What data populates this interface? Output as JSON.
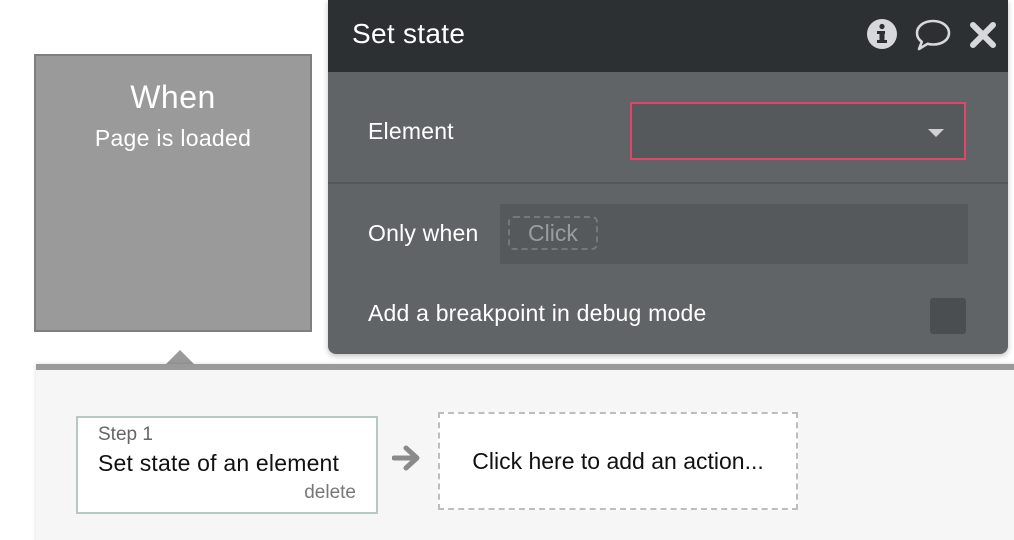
{
  "event": {
    "title": "When",
    "subtitle": "Page is loaded"
  },
  "workflow": {
    "step": {
      "label": "Step 1",
      "title": "Set state of an element",
      "delete_label": "delete"
    },
    "add_action_label": "Click here to add an action..."
  },
  "panel": {
    "title": "Set state",
    "icons": {
      "info": "info-icon",
      "comment": "comment-icon",
      "close": "close-icon"
    },
    "element": {
      "label": "Element",
      "value": ""
    },
    "only_when": {
      "label": "Only when",
      "chip_label": "Click"
    },
    "breakpoint": {
      "label": "Add a breakpoint in debug mode",
      "checked": false
    }
  },
  "colors": {
    "panel_header": "#2c3033",
    "panel_body": "#616466",
    "event_card": "#9a9a9a",
    "dropdown_error_border": "#e0466c"
  }
}
